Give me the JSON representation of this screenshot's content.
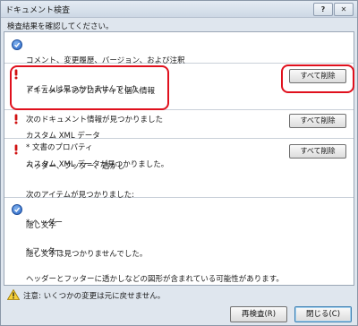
{
  "window": {
    "title": "ドキュメント検査",
    "help_glyph": "?",
    "close_glyph": "✕"
  },
  "instruction": "検査結果を確認してください。",
  "sections": [
    {
      "status": "ok",
      "lines": [
        "コメント、変更履歴、バージョン、および注釈",
        "アイテムは見つかりませんでした。"
      ],
      "button": ""
    },
    {
      "status": "found",
      "lines": [
        "ドキュメントのプロパティと個人情報",
        "次のドキュメント情報が見つかりました",
        "* 文書のプロパティ"
      ],
      "button": "すべて削除"
    },
    {
      "status": "found",
      "lines": [
        "カスタム XML データ",
        "カスタム XML データが見つかりました。"
      ],
      "button": "すべて削除"
    },
    {
      "status": "found",
      "lines": [
        "ヘッダー、フッター、透かし",
        "次のアイテムが見つかりました:",
        "* ヘッダー",
        "* フッター",
        "ヘッダーとフッターに透かしなどの図形が含まれている可能性があります。"
      ],
      "button": "すべて削除"
    },
    {
      "status": "ok",
      "lines": [
        "隠し文字",
        "隠し文字は見つかりませんでした。"
      ],
      "button": ""
    }
  ],
  "footer": {
    "warning": "注意: いくつかの変更は元に戻せません。",
    "reinspect_label": "再検査(R)",
    "close_label": "閉じる(C)"
  },
  "colors": {
    "highlight": "#e0101d",
    "found_icon": "#d01010",
    "ok_icon": "#2a66c7"
  }
}
